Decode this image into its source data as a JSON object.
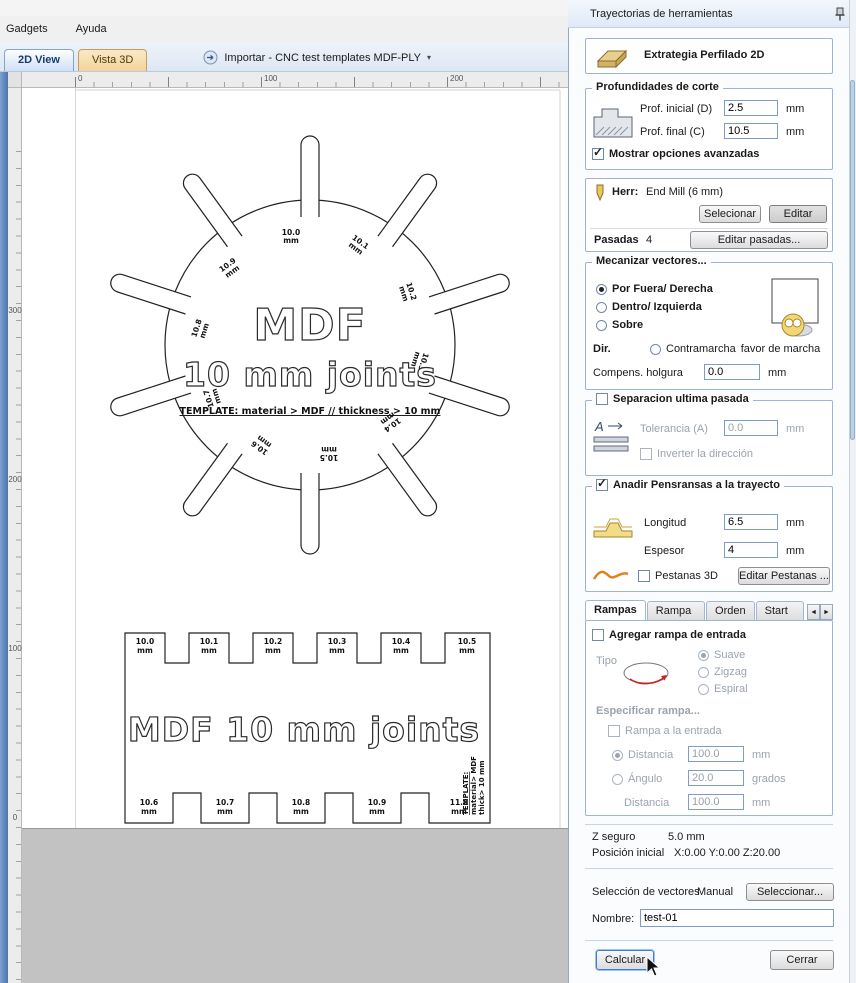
{
  "menubar": {
    "items": [
      "Gadgets",
      "Ayuda"
    ]
  },
  "view_tabs": {
    "tab_2d": "2D View",
    "tab_3d": "Vista 3D"
  },
  "toolbar": {
    "import_label": "Importar - CNC test templates MDF-PLY",
    "dropdown_arrow": "▾"
  },
  "rulers": {
    "top": [
      "0",
      "100",
      "200"
    ],
    "left": [
      "300",
      "200",
      "100",
      "0"
    ]
  },
  "drawing": {
    "gear": {
      "title1": "MDF",
      "title2": "10 mm joints",
      "template_line": "TEMPLATE: material > MDF // thickness > 10 mm",
      "labels": [
        {
          "num": "10.0",
          "unit": "mm"
        },
        {
          "num": "10.1",
          "unit": "mm"
        },
        {
          "num": "10.2",
          "unit": "mm"
        },
        {
          "num": "10.3",
          "unit": "mm"
        },
        {
          "num": "10.4",
          "unit": "mm"
        },
        {
          "num": "10.5",
          "unit": "mm"
        },
        {
          "num": "10.6",
          "unit": "mm"
        },
        {
          "num": "10.7",
          "unit": "mm"
        },
        {
          "num": "10.8",
          "unit": "mm"
        },
        {
          "num": "10.9",
          "unit": "mm"
        }
      ]
    },
    "comb": {
      "title": "MDF 10 mm joints",
      "top_labels": [
        {
          "num": "10.0",
          "unit": "mm"
        },
        {
          "num": "10.1",
          "unit": "mm"
        },
        {
          "num": "10.2",
          "unit": "mm"
        },
        {
          "num": "10.3",
          "unit": "mm"
        },
        {
          "num": "10.4",
          "unit": "mm"
        },
        {
          "num": "10.5",
          "unit": "mm"
        }
      ],
      "bottom_labels": [
        {
          "num": "10.6",
          "unit": "mm"
        },
        {
          "num": "10.7",
          "unit": "mm"
        },
        {
          "num": "10.8",
          "unit": "mm"
        },
        {
          "num": "10.9",
          "unit": "mm"
        },
        {
          "num": "11.0",
          "unit": "mm"
        }
      ],
      "side_lines": [
        "TEMPLATE:",
        "material> MDF",
        "thick> 10 mm"
      ]
    }
  },
  "panel": {
    "title": "Trayectorias de herramientas",
    "strategy_label": "Extrategia Perfilado 2D",
    "depths": {
      "title": "Profundidades de corte",
      "start_label": "Prof. inicial (D)",
      "start_value": "2.5",
      "start_unit": "mm",
      "final_label": "Prof. final (C)",
      "final_value": "10.5",
      "final_unit": "mm",
      "advanced_label": "Mostrar opciones avanzadas"
    },
    "tool": {
      "label": "Herr:",
      "name": "End Mill (6 mm)",
      "select_button": "Selecionar",
      "edit_button": "Editar",
      "passes_label": "Pasadas",
      "passes_value": "4",
      "edit_passes_button": "Editar pasadas..."
    },
    "vectors": {
      "title": "Mecanizar vectores...",
      "option_outside": "Por Fuera/ Derecha",
      "option_inside": "Dentro/ Izquierda",
      "option_on": "Sobre",
      "dir_label": "Dir.",
      "dir_option1": "Contramarcha",
      "dir_option2": "favor de marcha",
      "allowance_label": "Compens. holgura",
      "allowance_value": "0.0",
      "allowance_unit": "mm"
    },
    "last_pass": {
      "title": "Separacion ultima pasada",
      "icon_letter": "A",
      "tolerance_label": "Tolerancia (A)",
      "tolerance_value": "0.0",
      "tolerance_unit": "mm",
      "reverse_label": "Inverter la dirección"
    },
    "tabs_section": {
      "title": "Anadir Pensransas a la trayecto",
      "length_label": "Longitud",
      "length_value": "6.5",
      "length_unit": "mm",
      "thickness_label": "Espesor",
      "thickness_value": "4",
      "thickness_unit": "mm",
      "tabs3d_label": "Pestanas 3D",
      "edit_tabs_button": "Editar Pestanas ..."
    },
    "ramp_tabs": {
      "tab1": "Rampas",
      "tab2": "Rampa L.",
      "tab3": "Orden",
      "tab4": "Start At",
      "left_arrow": "◄",
      "right_arrow": "►"
    },
    "ramp": {
      "add_label": "Agregar rampa de entrada",
      "type_label": "Tipo",
      "type_smooth": "Suave",
      "type_zigzag": "Zigzag",
      "type_spiral": "Espiral",
      "specify_label": "Especificar rampa...",
      "lead_label": "Rampa a la entrada",
      "distance_label": "Distancia",
      "distance_value": "100.0",
      "distance_unit": "mm",
      "angle_label": "Ángulo",
      "angle_value": "20.0",
      "angle_unit": "grados",
      "distance2_label": "Distancia",
      "distance2_value": "100.0",
      "distance2_unit": "mm"
    },
    "info": {
      "zsafe_label": "Z seguro",
      "zsafe_value": "5.0 mm",
      "home_label": "Posición inicial",
      "home_value": "X:0.00 Y:0.00 Z:20.00"
    },
    "selection": {
      "label": "Selección de vectores",
      "mode": "Manual",
      "button": "Seleccionar..."
    },
    "name_field": {
      "label": "Nombre:",
      "value": "test-01"
    },
    "actions": {
      "calculate": "Calcular",
      "close": "Cerrar"
    }
  }
}
